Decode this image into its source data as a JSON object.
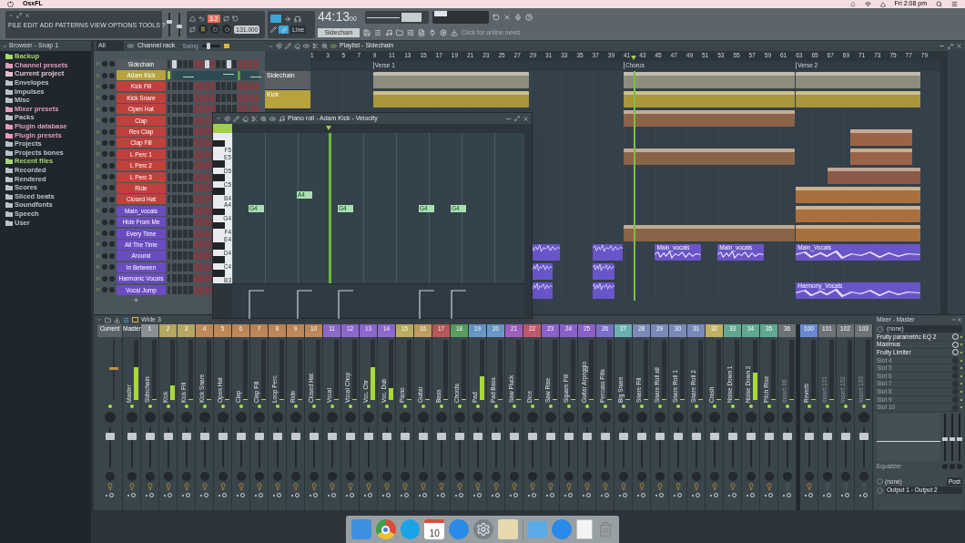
{
  "menubar": {
    "app": "OsxFL",
    "clock": "Fri 2:08 pm"
  },
  "toolbar": {
    "master_volume": {
      "level": 0.6
    },
    "master_pitch": {
      "level": 0.4
    },
    "menu": [
      "FILE",
      "EDIT",
      "ADD",
      "PATTERNS",
      "VIEW",
      "OPTIONS",
      "TOOLS",
      "?"
    ],
    "pattern_number": "3.2",
    "tempo": "131",
    "tempo_fraction": ".000",
    "time": "44:13",
    "time_fraction": "00",
    "snap": "Line",
    "pattern": "Sidechain",
    "news": "Click for online news"
  },
  "browser": {
    "title": "Browser - Snap 1",
    "items": [
      {
        "label": "Backup",
        "color": "#a8d86a"
      },
      {
        "label": "Channel presets",
        "color": "#e39ab8"
      },
      {
        "label": "Current project",
        "color": "#e3c2cf"
      },
      {
        "label": "Envelopes",
        "color": "#b8c4cc"
      },
      {
        "label": "Impulses",
        "color": "#b8c4cc"
      },
      {
        "label": "Misc",
        "color": "#b8c4cc"
      },
      {
        "label": "Mixer presets",
        "color": "#e39ab8"
      },
      {
        "label": "Packs",
        "color": "#b8c4cc"
      },
      {
        "label": "Plugin database",
        "color": "#e39ab8"
      },
      {
        "label": "Plugin presets",
        "color": "#e39ab8"
      },
      {
        "label": "Projects",
        "color": "#b8c4cc"
      },
      {
        "label": "Projects bones",
        "color": "#b8c4cc"
      },
      {
        "label": "Recent files",
        "color": "#a8d86a"
      },
      {
        "label": "Recorded",
        "color": "#b8c4cc"
      },
      {
        "label": "Rendered",
        "color": "#b8c4cc"
      },
      {
        "label": "Scores",
        "color": "#b8c4cc"
      },
      {
        "label": "Sliced beats",
        "color": "#b8c4cc"
      },
      {
        "label": "Soundfonts",
        "color": "#b8c4cc"
      },
      {
        "label": "Speech",
        "color": "#b8c4cc"
      },
      {
        "label": "User",
        "color": "#b8c4cc"
      }
    ]
  },
  "channel_rack": {
    "filter": "All",
    "title": "Channel rack",
    "swing": "Swing",
    "swing_slider": {
      "level": 0.3
    },
    "channels": [
      {
        "name": "Sidechain",
        "color": "#55595e",
        "selected": false,
        "kind": "steps",
        "steps": [
          true,
          false,
          false,
          false,
          false,
          false,
          true,
          false,
          false,
          false,
          true,
          false,
          false,
          false,
          false,
          false
        ]
      },
      {
        "name": "Adam Kick",
        "color": "#b8a23c",
        "selected": true,
        "kind": "preview"
      },
      {
        "name": "Kick Fill",
        "color": "#c0403c",
        "selected": false,
        "kind": "steps"
      },
      {
        "name": "Kick Snare",
        "color": "#c0403c",
        "selected": false,
        "kind": "steps"
      },
      {
        "name": "Open Hat",
        "color": "#c0403c",
        "selected": false,
        "kind": "steps"
      },
      {
        "name": "Clap",
        "color": "#c0403c",
        "selected": false,
        "kind": "steps"
      },
      {
        "name": "Rev Clap",
        "color": "#c0403c",
        "selected": false,
        "kind": "steps"
      },
      {
        "name": "Clap Fill",
        "color": "#c0403c",
        "selected": false,
        "kind": "steps"
      },
      {
        "name": "L Perc 1",
        "color": "#c0403c",
        "selected": false,
        "kind": "steps"
      },
      {
        "name": "L Perc 2",
        "color": "#c0403c",
        "selected": false,
        "kind": "steps"
      },
      {
        "name": "L Perc 3",
        "color": "#c0403c",
        "selected": false,
        "kind": "steps"
      },
      {
        "name": "Ride",
        "color": "#c0403c",
        "selected": false,
        "kind": "steps"
      },
      {
        "name": "Closed Hat",
        "color": "#c0403c",
        "selected": false,
        "kind": "steps"
      },
      {
        "name": "Main_vocals",
        "color": "#6a4cc0",
        "selected": false,
        "kind": "steps"
      },
      {
        "name": "Hide From Me",
        "color": "#6a4cc0",
        "selected": false,
        "kind": "steps"
      },
      {
        "name": "Every Time",
        "color": "#6a4cc0",
        "selected": false,
        "kind": "steps"
      },
      {
        "name": "All The Time",
        "color": "#6a4cc0",
        "selected": false,
        "kind": "steps"
      },
      {
        "name": "Around",
        "color": "#6a4cc0",
        "selected": false,
        "kind": "steps"
      },
      {
        "name": "In Between",
        "color": "#6a4cc0",
        "selected": false,
        "kind": "steps"
      },
      {
        "name": "Harmonic Vocals",
        "color": "#6a4cc0",
        "selected": false,
        "kind": "steps"
      },
      {
        "name": "Vocal Jump",
        "color": "#6a4cc0",
        "selected": false,
        "kind": "steps"
      }
    ]
  },
  "playlist": {
    "title": "Playlist - Sidechain",
    "ruler": [
      "1",
      "3",
      "5",
      "7",
      "9",
      "11",
      "13",
      "15",
      "17",
      "19",
      "21",
      "23",
      "25",
      "27",
      "29",
      "31",
      "33",
      "35",
      "37",
      "39",
      "41",
      "43",
      "45",
      "47",
      "49",
      "51",
      "53",
      "55",
      "57",
      "59",
      "61",
      "63",
      "65",
      "67",
      "69",
      "71",
      "73",
      "75",
      "77",
      "79"
    ],
    "markers": [
      "Verse 1",
      "Chorus",
      "Verse 2"
    ],
    "tracks": [
      {
        "name": "Sidechain",
        "color": "#5b5f63",
        "clips": [
          {
            "kind": "pattern",
            "color": "#8c8d7c"
          },
          {
            "kind": "pattern",
            "color": "#8c8d7c"
          },
          {
            "kind": "pattern",
            "color": "#8c8d7c"
          }
        ]
      },
      {
        "name": "Kick",
        "color": "#b8a23c",
        "clips": [
          {
            "kind": "pattern",
            "color": "#a8963a"
          },
          {
            "kind": "pattern",
            "color": "#a8963a"
          },
          {
            "kind": "pattern",
            "color": "#a8963a"
          }
        ]
      },
      {
        "clips": [
          {
            "kind": "pattern",
            "color": "#8a6448"
          }
        ]
      },
      {
        "clips": [
          {
            "kind": "pattern",
            "color": "#9c6446"
          }
        ]
      },
      {
        "clips": [
          {
            "kind": "pattern",
            "color": "#8a6448"
          },
          {
            "kind": "pattern",
            "color": "#9c6446"
          }
        ]
      },
      {
        "clips": [
          {
            "kind": "pattern",
            "color": "#8a5a48"
          }
        ]
      },
      {
        "clips": [
          {
            "kind": "pattern",
            "color": "#a8703e"
          }
        ]
      },
      {
        "clips": [
          {
            "kind": "pattern",
            "color": "#a8703e"
          }
        ]
      },
      {
        "clips": [
          {
            "kind": "pattern",
            "color": "#8a6448"
          },
          {
            "kind": "pattern",
            "color": "#a8703e"
          }
        ]
      },
      {
        "clips": [
          {
            "kind": "audio",
            "color": "#6a55c8"
          },
          {
            "kind": "audio",
            "color": "#6a55c8"
          },
          {
            "kind": "audio",
            "color": "#6a55c8",
            "label": "Main_vocals"
          },
          {
            "kind": "audio",
            "color": "#6a55c8",
            "label": "Main_vocals"
          },
          {
            "kind": "audio",
            "color": "#6a55c8",
            "label": "Main_Vocals"
          }
        ]
      },
      {
        "clips": [
          {
            "kind": "audio",
            "color": "#6a55c8"
          },
          {
            "kind": "audio",
            "color": "#6a55c8"
          }
        ]
      },
      {
        "clips": [
          {
            "kind": "audio",
            "color": "#6a55c8"
          },
          {
            "kind": "audio",
            "color": "#6a55c8"
          },
          {
            "kind": "audio",
            "color": "#6a55c8",
            "label": "Harmony_Vocals"
          }
        ]
      }
    ]
  },
  "piano_roll": {
    "title": "Piano roll - Adam Kick - Velocity",
    "keys": [
      "F5",
      "E5",
      "D5",
      "C5",
      "B4",
      "A4",
      "G4",
      "F4",
      "E4",
      "D4",
      "C4",
      "B3"
    ],
    "notes": [
      {
        "label": "G4"
      },
      {
        "label": "A4"
      },
      {
        "label": "G4"
      },
      {
        "label": "G4"
      },
      {
        "label": "G4"
      }
    ]
  },
  "mixer": {
    "title": "Wide 3",
    "strips": [
      {
        "kind": "current",
        "header": "Current",
        "color": "#5c646a"
      },
      {
        "kind": "master",
        "header": "Master",
        "name": "Master",
        "color": "#4a5258",
        "empty": false,
        "level": 0.55
      },
      {
        "kind": "insert",
        "header": "1",
        "name": "Sidechain",
        "color": "#8a8f94",
        "empty": false,
        "level": 0
      },
      {
        "kind": "insert",
        "header": "2",
        "name": "Kick",
        "color": "#b5a660",
        "empty": false,
        "level": 0.25
      },
      {
        "kind": "insert",
        "header": "3",
        "name": "Kick Fill",
        "color": "#b5a660",
        "empty": false,
        "level": 0
      },
      {
        "kind": "insert",
        "header": "4",
        "name": "Kick Snare",
        "color": "#c08a5a",
        "empty": false,
        "level": 0
      },
      {
        "kind": "insert",
        "header": "5",
        "name": "Open Hat",
        "color": "#c08a5a",
        "empty": false,
        "level": 0
      },
      {
        "kind": "insert",
        "header": "6",
        "name": "Clap",
        "color": "#c08a5a",
        "empty": false,
        "level": 0
      },
      {
        "kind": "insert",
        "header": "7",
        "name": "Clap Fill",
        "color": "#c08a5a",
        "empty": false,
        "level": 0
      },
      {
        "kind": "insert",
        "header": "8",
        "name": "Loop Perc",
        "color": "#c08a5a",
        "empty": false,
        "level": 0
      },
      {
        "kind": "insert",
        "header": "9",
        "name": "Ride",
        "color": "#c08a5a",
        "empty": false,
        "level": 0
      },
      {
        "kind": "insert",
        "header": "10",
        "name": "Closed Hat",
        "color": "#c08a5a",
        "empty": false,
        "level": 0
      },
      {
        "kind": "insert",
        "header": "11",
        "name": "Vocal",
        "color": "#8f6ad0",
        "empty": false,
        "level": 0
      },
      {
        "kind": "insert",
        "header": "12",
        "name": "Vocal Chop",
        "color": "#8f6ad0",
        "empty": false,
        "level": 0
      },
      {
        "kind": "insert",
        "header": "13",
        "name": "Voc. Chr",
        "color": "#8f6ad0",
        "empty": false,
        "level": 0.55
      },
      {
        "kind": "insert",
        "header": "14",
        "name": "Voc. Dub",
        "color": "#8f6ad0",
        "empty": false,
        "level": 0.2
      },
      {
        "kind": "insert",
        "header": "15",
        "name": "Piano",
        "color": "#c2b060",
        "empty": false,
        "level": 0
      },
      {
        "kind": "insert",
        "header": "16",
        "name": "Guitar",
        "color": "#c2a060",
        "empty": false,
        "level": 0
      },
      {
        "kind": "insert",
        "header": "17",
        "name": "Bass",
        "color": "#b85a5a",
        "empty": false,
        "level": 0
      },
      {
        "kind": "insert",
        "header": "18",
        "name": "Chords",
        "color": "#5aa060",
        "empty": false,
        "level": 0
      },
      {
        "kind": "insert",
        "header": "19",
        "name": "Pad",
        "color": "#6a9ac8",
        "empty": false,
        "level": 0.4
      },
      {
        "kind": "insert",
        "header": "20",
        "name": "Pad Bass",
        "color": "#6a9ac8",
        "empty": false,
        "level": 0
      },
      {
        "kind": "insert",
        "header": "21",
        "name": "Saw Pluck",
        "color": "#a060c0",
        "empty": false,
        "level": 0
      },
      {
        "kind": "insert",
        "header": "22",
        "name": "Dice",
        "color": "#c05a6a",
        "empty": false,
        "level": 0
      },
      {
        "kind": "insert",
        "header": "23",
        "name": "Saw Rise",
        "color": "#8a60c8",
        "empty": false,
        "level": 0
      },
      {
        "kind": "insert",
        "header": "24",
        "name": "Square Fill",
        "color": "#8a60c8",
        "empty": false,
        "level": 0
      },
      {
        "kind": "insert",
        "header": "25",
        "name": "Guitar Arpeggio",
        "color": "#8a60c8",
        "empty": false,
        "level": 0
      },
      {
        "kind": "insert",
        "header": "26",
        "name": "Percuss Fills",
        "color": "#7a70c8",
        "empty": false,
        "level": 0
      },
      {
        "kind": "insert",
        "header": "27",
        "name": "Big Snare",
        "color": "#6ab0b0",
        "empty": false,
        "level": 0
      },
      {
        "kind": "insert",
        "header": "28",
        "name": "Snare Fill",
        "color": "#7a8ab8",
        "empty": false,
        "level": 0
      },
      {
        "kind": "insert",
        "header": "29",
        "name": "Snare Roll all",
        "color": "#7a8ab8",
        "empty": false,
        "level": 0
      },
      {
        "kind": "insert",
        "header": "30",
        "name": "Snare Roll 1",
        "color": "#7a8ab8",
        "empty": false,
        "level": 0
      },
      {
        "kind": "insert",
        "header": "31",
        "name": "Snare Roll 2",
        "color": "#7a8ab8",
        "empty": false,
        "level": 0
      },
      {
        "kind": "insert",
        "header": "32",
        "name": "Crash",
        "color": "#c0b060",
        "empty": false,
        "level": 0
      },
      {
        "kind": "insert",
        "header": "33",
        "name": "Noise Down 1",
        "color": "#60a890",
        "empty": false,
        "level": 0
      },
      {
        "kind": "insert",
        "header": "34",
        "name": "Noise Down 2",
        "color": "#60a890",
        "empty": false,
        "level": 0.45
      },
      {
        "kind": "insert",
        "header": "35",
        "name": "Pitch Rise",
        "color": "#60a890",
        "empty": false,
        "level": 0
      },
      {
        "kind": "insert",
        "header": "36",
        "name": "Insert 36",
        "color": "#6c7276",
        "empty": true,
        "level": 0
      }
    ],
    "sends": [
      {
        "kind": "insert",
        "header": "100",
        "name": "Reverb",
        "color": "#6a8ad0",
        "empty": false,
        "level": 0
      },
      {
        "kind": "insert",
        "header": "101",
        "name": "Insert 101",
        "color": "#6c7276",
        "empty": true,
        "level": 0
      },
      {
        "kind": "insert",
        "header": "102",
        "name": "Insert 102",
        "color": "#6c7276",
        "empty": true,
        "level": 0
      },
      {
        "kind": "insert",
        "header": "103",
        "name": "Insert 103",
        "color": "#6c7276",
        "empty": true,
        "level": 0
      }
    ]
  },
  "mixer_panel": {
    "title": "Mixer - Master",
    "input": "(none)",
    "slots": [
      {
        "name": "Fruity parametric EQ 2",
        "empty": false
      },
      {
        "name": "Maximus",
        "empty": false
      },
      {
        "name": "Fruity Limiter",
        "empty": false
      },
      {
        "name": "Slot 4",
        "empty": true
      },
      {
        "name": "Slot 5",
        "empty": true
      },
      {
        "name": "Slot 6",
        "empty": true
      },
      {
        "name": "Slot 7",
        "empty": true
      },
      {
        "name": "Slot 8",
        "empty": true
      },
      {
        "name": "Slot 9",
        "empty": true
      },
      {
        "name": "Slot 10",
        "empty": true
      }
    ],
    "eq_bands": [
      {
        "level": 0.45
      },
      {
        "level": 0.45
      },
      {
        "level": 0.45
      }
    ],
    "eq_label": "Equalizer",
    "sidechain": "(none)",
    "post": "Post",
    "output": "Output 1 - Output 2"
  },
  "dock": {
    "calendar_day": "10"
  }
}
